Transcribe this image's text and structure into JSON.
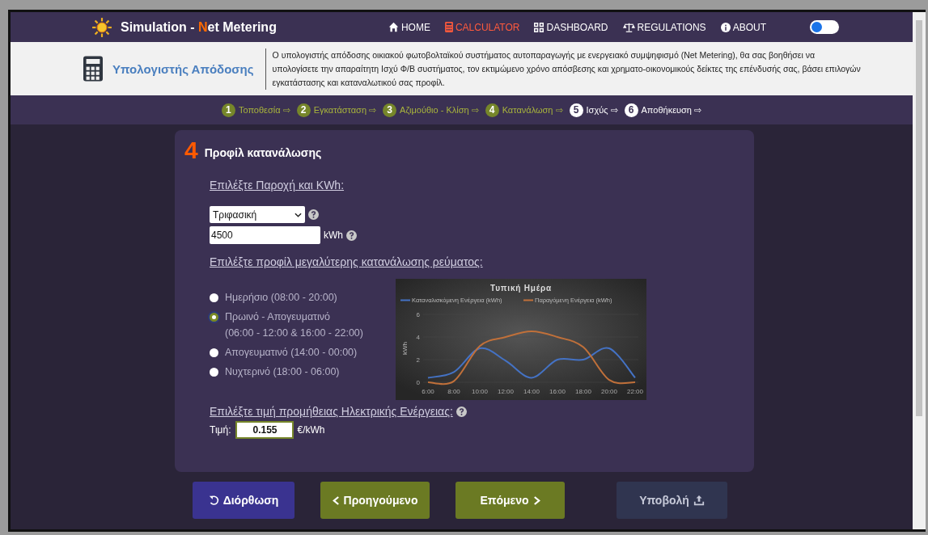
{
  "navbar": {
    "title_parts": [
      {
        "text": "Simulation - ",
        "accent": false
      },
      {
        "text": "N",
        "accent": true
      },
      {
        "text": "et Metering",
        "accent": false
      }
    ],
    "links": [
      {
        "label": "HOME",
        "selected": false
      },
      {
        "label": "CALCULATOR",
        "selected": true
      },
      {
        "label": "DASHBOARD",
        "selected": false
      },
      {
        "label": "REGULATIONS",
        "selected": false
      },
      {
        "label": "ABOUT",
        "selected": false
      }
    ],
    "theme_toggle": {
      "on": false
    }
  },
  "header": {
    "title": "Υπολογιστής Απόδοσης",
    "description": "Ο υπολογιστής απόδοσης οικιακού φωτοβολταϊκού συστήματος αυτοπαραγωγής με ενεργειακό συμψηφισμό (Net Metering), θα σας βοηθήσει να υπολογίσετε την απαραίτητη Ισχύ Φ/Β συστήματος, τον εκτιμώμενο χρόνο απόσβεσης και χρηματο-οικονομικούς δείκτες της επένδυσής σας, βάσει επιλογών εγκατάστασης και καταναλωτικού σας προφίλ."
  },
  "steps": [
    {
      "number": "1",
      "label": "Τοποθεσία",
      "arrow": "⇨",
      "completed": true
    },
    {
      "number": "2",
      "label": "Εγκατάσταση",
      "arrow": "⇨",
      "completed": true
    },
    {
      "number": "3",
      "label": "Αζιμούθιο - Κλίση",
      "arrow": "⇨",
      "completed": true
    },
    {
      "number": "4",
      "label": "Κατανάλωση",
      "arrow": "⇨",
      "completed": true
    },
    {
      "number": "5",
      "label": "Ισχύς",
      "arrow": "⇨",
      "completed": false
    },
    {
      "number": "6",
      "label": "Αποθήκευση",
      "arrow": "⇨",
      "completed": false
    }
  ],
  "card": {
    "step_number": "4",
    "title": "Προφίλ κατανάλωσης",
    "supply_heading": "Επιλέξτε Παροχή και KWh:",
    "supply_select": {
      "value": "Τριφασική"
    },
    "kwh_field": {
      "value": "4500",
      "unit": "kWh"
    },
    "profile_heading": "Επιλέξτε προφίλ μεγαλύτερης κατανάλωσης ρεύματος:",
    "profiles": [
      {
        "lines": [
          "Ημερήσιο (08:00 - 20:00)"
        ],
        "selected": false
      },
      {
        "lines": [
          "Πρωινό - Απογευματινό",
          "(06:00 - 12:00 & 16:00 - 22:00)"
        ],
        "selected": true
      },
      {
        "lines": [
          "Απογευματινό (14:00 - 00:00)"
        ],
        "selected": false
      },
      {
        "lines": [
          "Νυχτερινό (18:00 - 06:00)"
        ],
        "selected": false
      }
    ],
    "chart_data": {
      "type": "line",
      "title": "Τυπική Ημέρα",
      "ylabel": "kWh",
      "legend": "top",
      "categories": [
        "6:00",
        "8:00",
        "10:00",
        "12:00",
        "14:00",
        "16:00",
        "18:00",
        "20:00",
        "22:00"
      ],
      "series": [
        {
          "name": "Καταναλισκόμενη Ενέργεια (kWh)",
          "color": "#4472c4",
          "values": [
            0.4,
            0.9,
            3,
            1.9,
            0.4,
            2,
            2,
            3,
            0.4
          ]
        },
        {
          "name": "Παραγόμενη Ενέργεια (kWh)",
          "color": "#c0703a",
          "values": [
            0,
            0.1,
            3.2,
            4,
            4.5,
            4,
            3.1,
            0.2,
            0
          ]
        }
      ],
      "ylim": [
        0,
        6
      ],
      "yticks": [
        0,
        2,
        4,
        6
      ]
    },
    "price_heading": "Επιλέξτε τιμή προμήθειας Ηλεκτρικής Ενέργειας:",
    "price_field": {
      "label": "Τιμή:",
      "value": "0.155",
      "unit": "€/kWh"
    }
  },
  "buttons": [
    {
      "label": "Διόρθωση",
      "kind": "reset"
    },
    {
      "label": "Προηγούμενο",
      "kind": "previous"
    },
    {
      "label": "Επόμενο",
      "kind": "next"
    },
    {
      "label": "Υποβολή",
      "kind": "submit"
    }
  ]
}
